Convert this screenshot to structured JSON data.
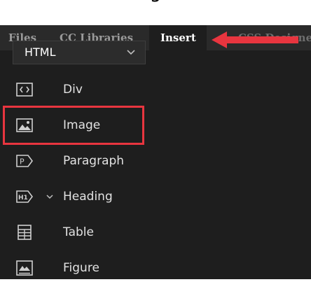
{
  "header_caption": "g",
  "tabs": [
    {
      "label": "Files",
      "active": false
    },
    {
      "label": "CC Libraries",
      "active": false
    },
    {
      "label": "Insert",
      "active": true
    },
    {
      "label": "CSS Designer",
      "active": false
    }
  ],
  "dropdown": {
    "selected": "HTML"
  },
  "items": [
    {
      "label": "Div",
      "icon": "div-icon"
    },
    {
      "label": "Image",
      "icon": "image-icon"
    },
    {
      "label": "Paragraph",
      "icon": "paragraph-icon"
    },
    {
      "label": "Heading",
      "icon": "heading-icon"
    },
    {
      "label": "Table",
      "icon": "table-icon"
    },
    {
      "label": "Figure",
      "icon": "figure-icon"
    }
  ],
  "colors": {
    "panel_bg": "#1e1e1e",
    "tabbar_bg": "#2a2a2a",
    "highlight": "#e8353f",
    "arrow": "#e8353f"
  }
}
